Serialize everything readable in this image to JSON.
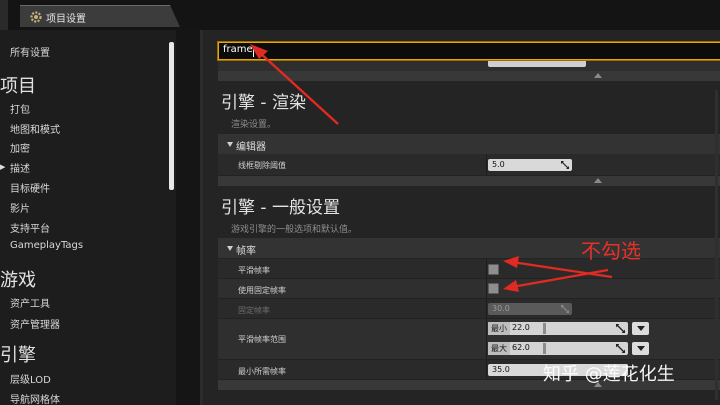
{
  "tab": {
    "title": "项目设置",
    "icon": "settings-gear-icon"
  },
  "sidebar": {
    "all_settings": "所有设置",
    "sections": [
      {
        "title": "项目",
        "items": [
          "打包",
          "地图和模式",
          "加密",
          "描述",
          "目标硬件",
          "影片",
          "支持平台",
          "GameplayTags"
        ],
        "selected_index": 3
      },
      {
        "title": "游戏",
        "items": [
          "资产工具",
          "资产管理器"
        ]
      },
      {
        "title": "引擎",
        "items": [
          "层级LOD",
          "导航网格体"
        ]
      }
    ]
  },
  "search": {
    "value": "frame"
  },
  "render_section": {
    "title": "引擎 - 渲染",
    "description": "渲染设置。",
    "category": "编辑器",
    "rows": [
      {
        "label": "线框剔除阈值",
        "value": "5.0"
      }
    ]
  },
  "general_section": {
    "title": "引擎 - 一般设置",
    "description": "游戏引擎的一般选项和默认值。",
    "category": "帧率",
    "rows": {
      "smooth_frame_rate": {
        "label": "平滑帧率",
        "checked": false
      },
      "use_fixed_frame_rate": {
        "label": "使用固定帧率",
        "checked": false
      },
      "fixed_frame_rate": {
        "label": "固定帧率",
        "value": "30.0",
        "enabled": false
      },
      "smoothed_frame_rate_range": {
        "label": "平滑帧率范围",
        "min_label": "最小",
        "min_value": "22.0",
        "max_label": "最大",
        "max_value": "62.0"
      },
      "min_desired_frame_rate": {
        "label": "最小所需帧率",
        "value": "35.0"
      }
    }
  },
  "annotation": {
    "text": "不勾选",
    "color": "#e8302a"
  },
  "watermark": {
    "text": "知乎 @莲花化生"
  }
}
